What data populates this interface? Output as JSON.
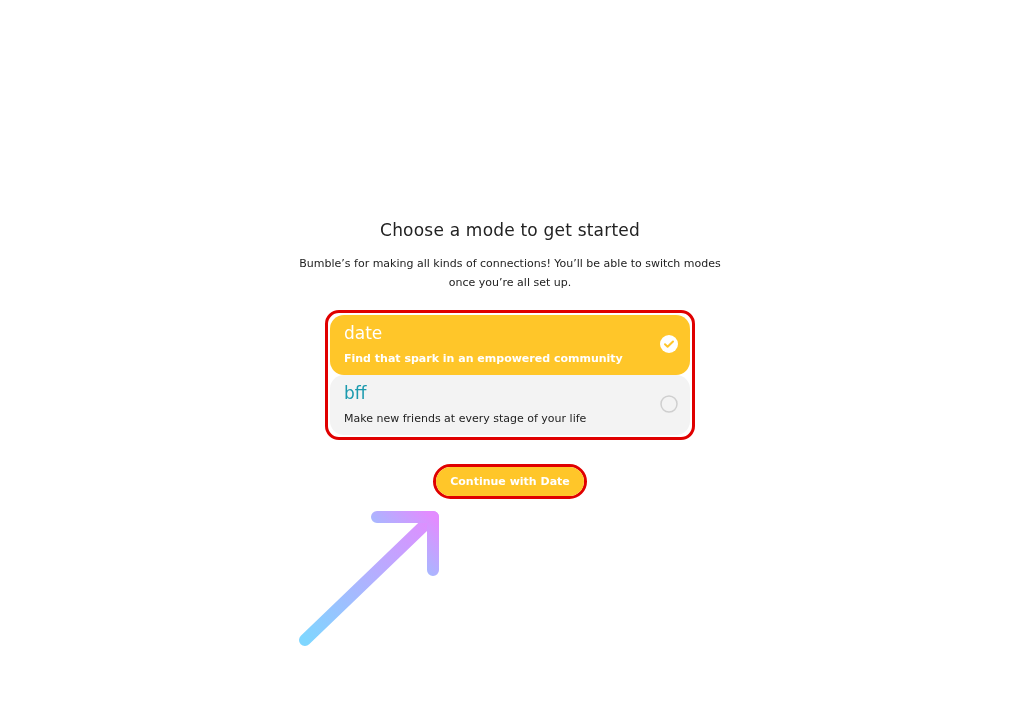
{
  "title": "Choose a mode to get started",
  "subtitle": "Bumble’s for making all kinds of connections! You’ll be able to switch modes once you’re all set up.",
  "modes": [
    {
      "name": "date",
      "description": "Find that spark in an empowered community",
      "selected": true,
      "color": "#ffffff"
    },
    {
      "name": "bff",
      "description": "Make new friends at every stage of your life",
      "selected": false,
      "color": "#1b9aae"
    }
  ],
  "button": "Continue with Date"
}
